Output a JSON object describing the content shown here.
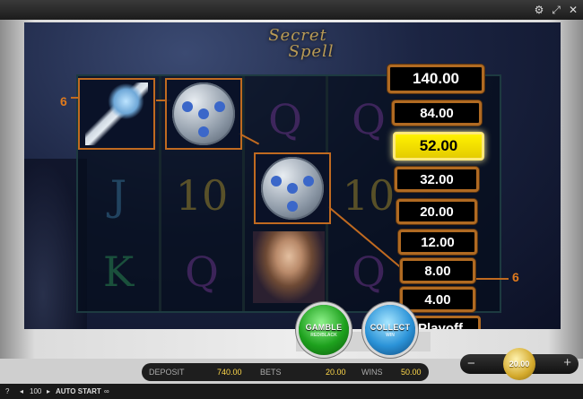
{
  "toolbar": {
    "icons": [
      "gear-icon",
      "fullscreen-icon",
      "mute-icon"
    ]
  },
  "game": {
    "logo": {
      "line1": "Secret",
      "line2": "Spell"
    },
    "reels": [
      [
        "gem-key",
        "J",
        "K"
      ],
      [
        "coin",
        "10",
        "Q"
      ],
      [
        "Q",
        "coin",
        "maiden"
      ],
      [
        "Q",
        "10",
        "Q"
      ]
    ],
    "win_line": {
      "left_number": "6",
      "right_number": "6"
    },
    "gamble_ladder": [
      "140.00",
      "84.00",
      "52.00",
      "32.00",
      "20.00",
      "12.00",
      "8.00",
      "4.00"
    ],
    "active_step": "52.00",
    "playoff_label": "Playoff"
  },
  "buttons": {
    "gamble_label": "GAMBLE",
    "gamble_sub": "RED/BLACK",
    "collect_label": "COLLECT",
    "collect_sub": "WIN"
  },
  "stats": {
    "deposit_label": "DEPOSIT",
    "deposit_value": "740.00",
    "bets_label": "BETS",
    "bets_value": "20.00",
    "wins_label": "WINS",
    "wins_value": "50.00"
  },
  "stake": {
    "minus": "−",
    "plus": "+",
    "value": "20.00"
  },
  "footer": {
    "help": "?",
    "autostart_count": "100",
    "autostart_label": "AUTO START",
    "loop_icon": "infinity-icon"
  }
}
